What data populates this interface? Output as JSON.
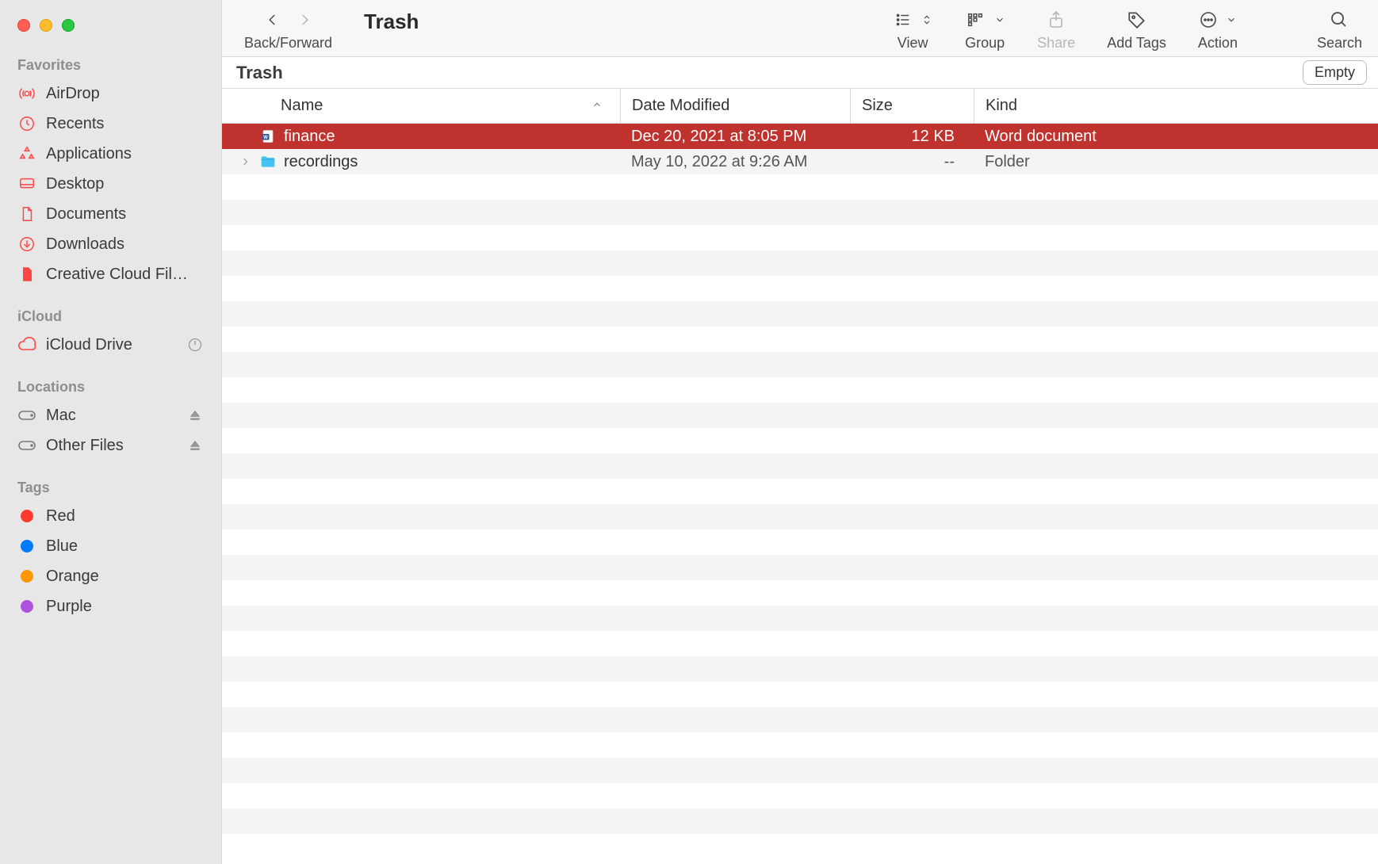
{
  "window": {
    "title": "Trash"
  },
  "toolbar": {
    "back_forward": "Back/Forward",
    "view": "View",
    "group": "Group",
    "share": "Share",
    "add_tags": "Add Tags",
    "action": "Action",
    "search": "Search"
  },
  "location": {
    "path": "Trash",
    "empty_button": "Empty"
  },
  "columns": {
    "name": "Name",
    "date": "Date Modified",
    "size": "Size",
    "kind": "Kind"
  },
  "rows": [
    {
      "name": "finance",
      "date": "Dec 20, 2021 at 8:05 PM",
      "size": "12 KB",
      "kind": "Word document",
      "type": "doc",
      "selected": true
    },
    {
      "name": "recordings",
      "date": "May 10, 2022 at 9:26 AM",
      "size": "--",
      "kind": "Folder",
      "type": "folder",
      "selected": false
    }
  ],
  "sidebar": {
    "favorites_label": "Favorites",
    "favorites": [
      {
        "label": "AirDrop",
        "icon": "airdrop"
      },
      {
        "label": "Recents",
        "icon": "clock"
      },
      {
        "label": "Applications",
        "icon": "apps"
      },
      {
        "label": "Desktop",
        "icon": "desktop"
      },
      {
        "label": "Documents",
        "icon": "document"
      },
      {
        "label": "Downloads",
        "icon": "download"
      },
      {
        "label": "Creative Cloud Fil…",
        "icon": "file"
      }
    ],
    "icloud_label": "iCloud",
    "icloud": [
      {
        "label": "iCloud Drive",
        "icon": "cloud",
        "trailing": "progress"
      }
    ],
    "locations_label": "Locations",
    "locations": [
      {
        "label": "Mac",
        "icon": "disk",
        "trailing": "eject"
      },
      {
        "label": "Other Files",
        "icon": "disk",
        "trailing": "eject"
      }
    ],
    "tags_label": "Tags",
    "tags": [
      {
        "label": "Red",
        "color": "#ff3b30"
      },
      {
        "label": "Blue",
        "color": "#007aff"
      },
      {
        "label": "Orange",
        "color": "#ff9500"
      },
      {
        "label": "Purple",
        "color": "#af52de"
      }
    ]
  }
}
